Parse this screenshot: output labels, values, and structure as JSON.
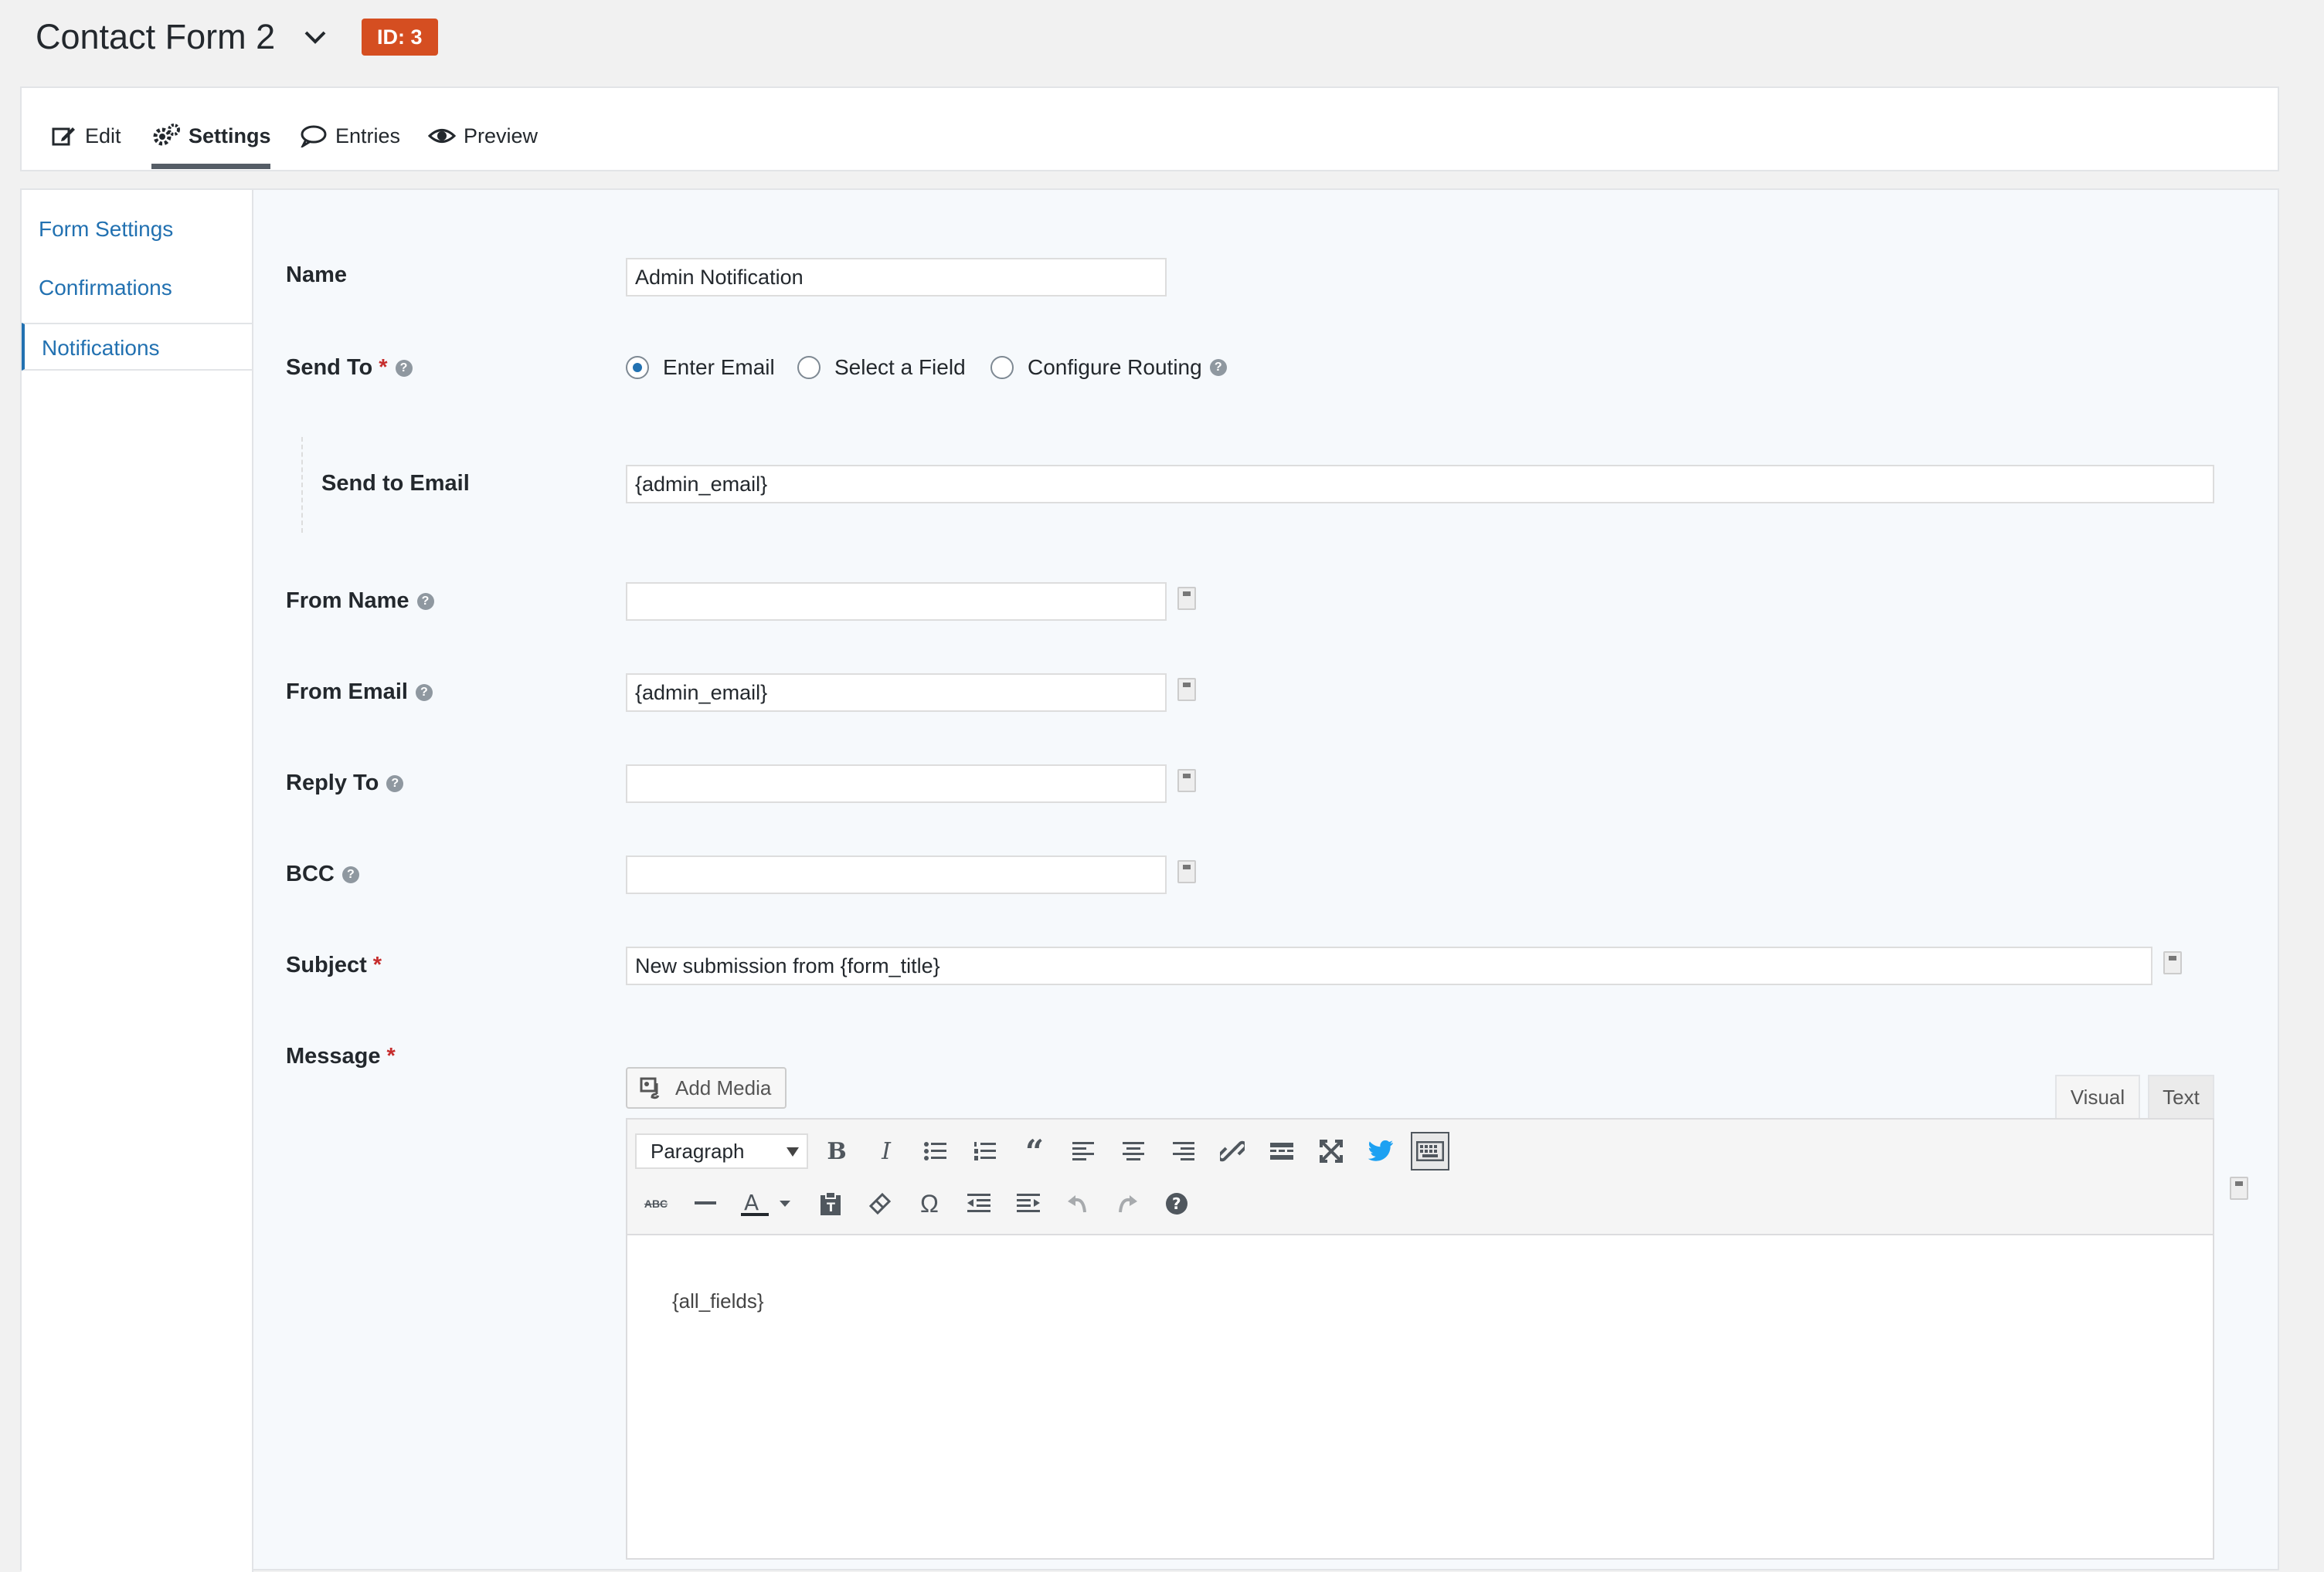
{
  "header": {
    "form_title": "Contact Form 2",
    "id_badge": "ID: 3",
    "badge_color": "#d54e21"
  },
  "tabs": [
    {
      "label": "Edit",
      "icon": "edit-icon"
    },
    {
      "label": "Settings",
      "icon": "gear-icon",
      "active": true
    },
    {
      "label": "Entries",
      "icon": "speech-bubble-icon"
    },
    {
      "label": "Preview",
      "icon": "eye-icon"
    }
  ],
  "sidebar": {
    "items": [
      {
        "label": "Form Settings"
      },
      {
        "label": "Confirmations"
      },
      {
        "label": "Notifications",
        "active": true
      }
    ]
  },
  "fields": {
    "name": {
      "label": "Name",
      "value": "Admin Notification"
    },
    "send_to": {
      "label": "Send To",
      "required_mark": "*",
      "options": [
        "Enter Email",
        "Select a Field",
        "Configure Routing"
      ],
      "selected": "Enter Email"
    },
    "send_to_email": {
      "label": "Send to Email",
      "value": "{admin_email}"
    },
    "from_name": {
      "label": "From Name",
      "value": ""
    },
    "from_email": {
      "label": "From Email",
      "value": "{admin_email}"
    },
    "reply_to": {
      "label": "Reply To",
      "value": ""
    },
    "bcc": {
      "label": "BCC",
      "value": ""
    },
    "subject": {
      "label": "Subject",
      "required_mark": "*",
      "value": "New submission from {form_title}"
    },
    "message": {
      "label": "Message",
      "required_mark": "*"
    }
  },
  "editor": {
    "add_media_label": "Add Media",
    "tab_visual": "Visual",
    "tab_text": "Text",
    "format_select": "Paragraph",
    "content": "{all_fields}",
    "toolbar_row1": [
      "bold-icon",
      "italic-icon",
      "bullet-list-icon",
      "numbered-list-icon",
      "blockquote-icon",
      "align-left-icon",
      "align-center-icon",
      "align-right-icon",
      "link-icon",
      "read-more-icon",
      "fullscreen-icon",
      "twitter-icon",
      "keyboard-icon"
    ],
    "toolbar_row2": [
      "strikethrough-icon",
      "horizontal-line-icon",
      "text-color-icon",
      "paste-text-icon",
      "clear-formatting-icon",
      "special-character-icon",
      "outdent-icon",
      "indent-icon",
      "undo-icon",
      "redo-icon",
      "help-icon"
    ]
  },
  "colors": {
    "link": "#2271b1",
    "required": "#c62d2d"
  }
}
